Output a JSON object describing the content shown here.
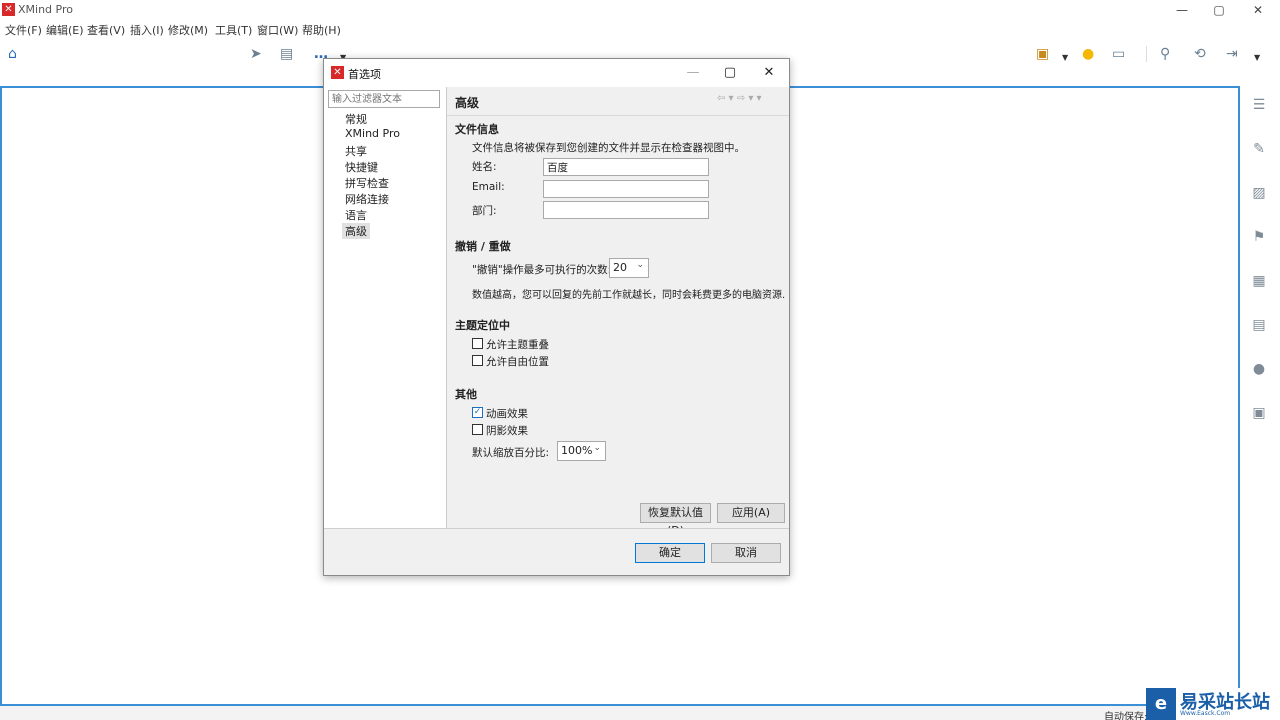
{
  "app": {
    "title": "XMind Pro",
    "logo_glyph": "✕"
  },
  "window_controls": {
    "minimize": "—",
    "maximize": "▢",
    "close": "✕"
  },
  "menu": [
    "文件(F)",
    "编辑(E)",
    "查看(V)",
    "插入(I)",
    "修改(M)",
    "工具(T)",
    "窗口(W)",
    "帮助(H)"
  ],
  "toolbar": {
    "icons": [
      "home-icon",
      "more-icon",
      "presentation-icon",
      "idea-icon",
      "panel-icon",
      "search-icon",
      "share-icon",
      "export-icon"
    ],
    "more_label": "…"
  },
  "right_panel_icons": [
    "outline-icon",
    "format-icon",
    "image-icon",
    "flag-icon",
    "label-icon",
    "notes-icon",
    "comment-icon",
    "task-icon"
  ],
  "status": {
    "autosave": "自动保存:"
  },
  "watermark": {
    "logo": "e",
    "text": "易采站长站",
    "sub": "Www.Easck.Com"
  },
  "dialog": {
    "title": "首选项",
    "filter_placeholder": "输入过滤器文本",
    "nav": [
      "常规",
      "XMind Pro",
      "共享",
      "快捷键",
      "拼写检查",
      "网络连接",
      "语言",
      "高级"
    ],
    "selected_nav": "高级",
    "section_title": "高级",
    "nav_arrows": "⇦ ▾ ⇨ ▾ ▾",
    "file_info": {
      "heading": "文件信息",
      "description": "文件信息将被保存到您创建的文件并显示在检查器视图中。",
      "name_label": "姓名:",
      "name_value": "百度",
      "email_label": "Email:",
      "email_value": "",
      "dept_label": "部门:",
      "dept_value": ""
    },
    "undo": {
      "heading": "撤销 / 重做",
      "max_label": "\"撤销\"操作最多可执行的次数:",
      "max_value": "20",
      "note": "数值越高，您可以回复的先前工作就越长，同时会耗费更多的电脑资源."
    },
    "topic_position": {
      "heading": "主题定位中",
      "allow_overlap": "允许主题重叠",
      "allow_overlap_checked": false,
      "allow_free": "允许自由位置",
      "allow_free_checked": false
    },
    "other": {
      "heading": "其他",
      "animation": "动画效果",
      "animation_checked": true,
      "shadow": "阴影效果",
      "shadow_checked": false,
      "zoom_label": "默认缩放百分比:",
      "zoom_value": "100%"
    },
    "restore_defaults": "恢复默认值(D)",
    "apply": "应用(A)",
    "ok": "确定",
    "cancel": "取消"
  }
}
